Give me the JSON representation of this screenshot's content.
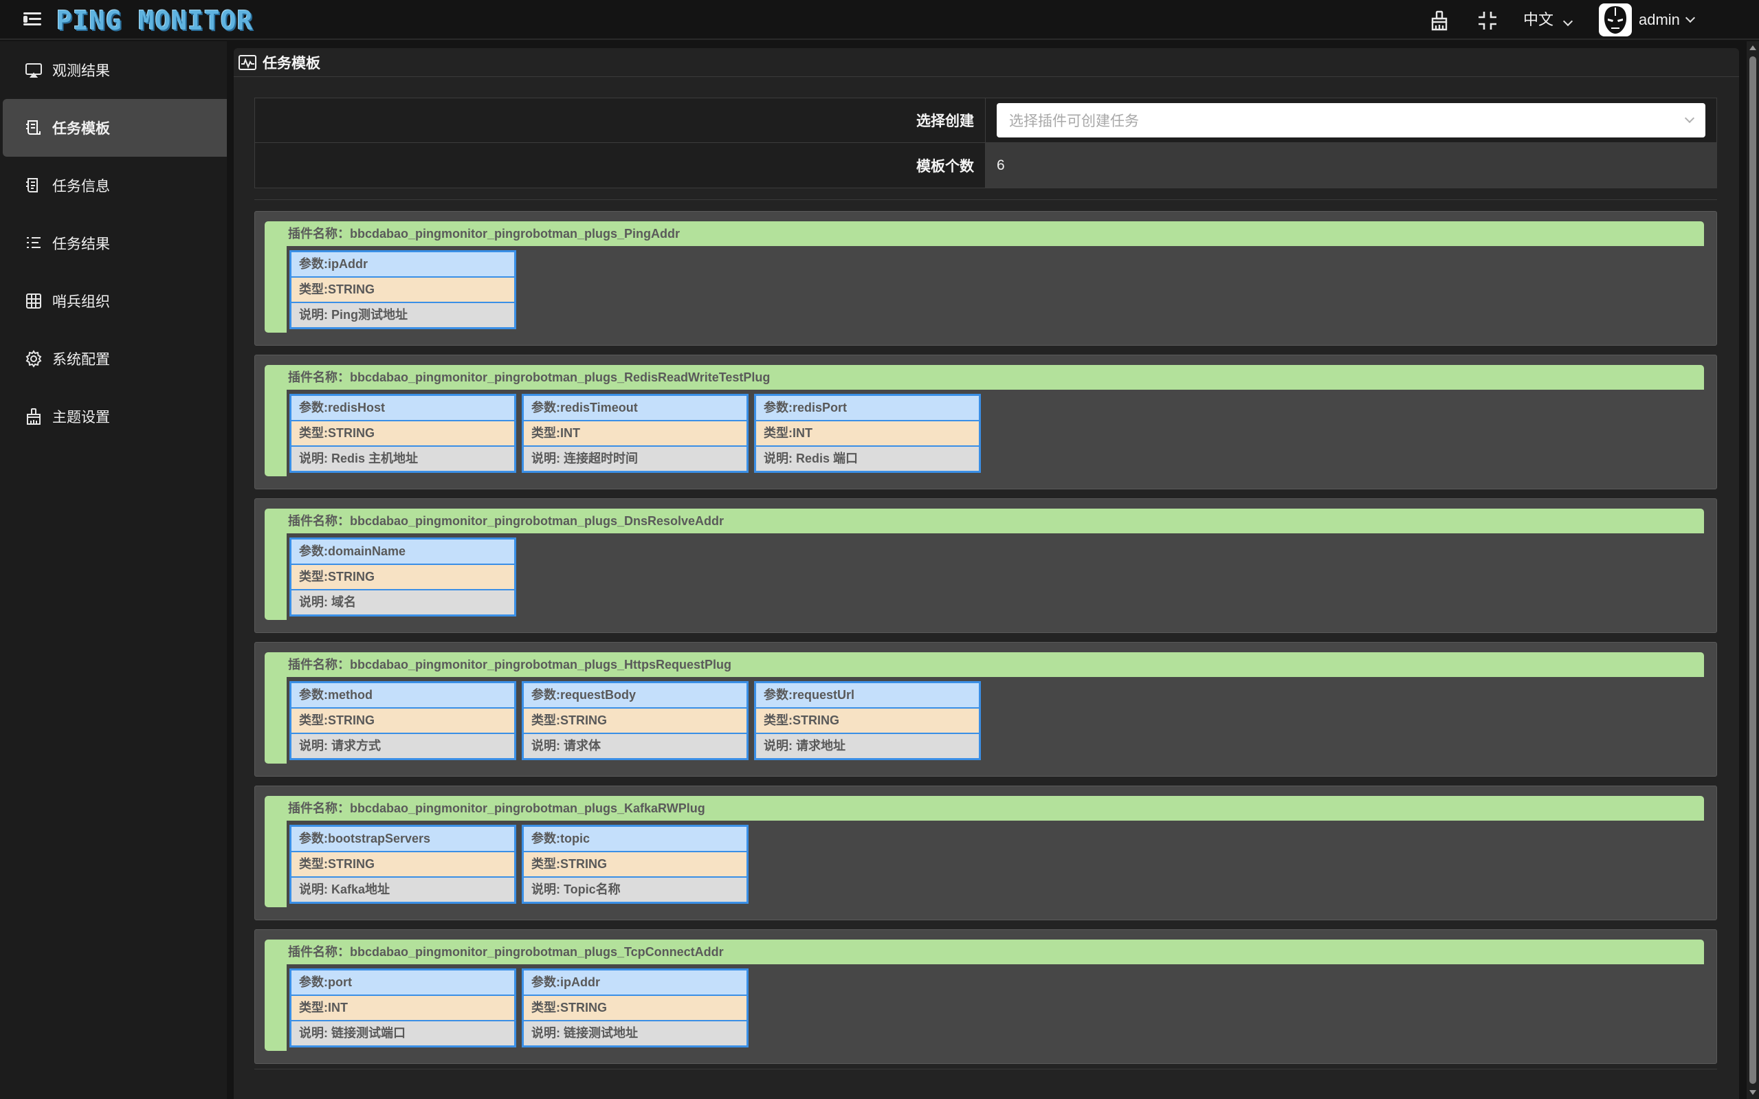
{
  "app": {
    "logo_text": "PING MONITOR",
    "language": "中文",
    "user_name": "admin"
  },
  "sidebar": {
    "items": [
      {
        "label": "观测结果",
        "icon": "monitor-icon"
      },
      {
        "label": "任务模板",
        "icon": "template-icon",
        "active": true
      },
      {
        "label": "任务信息",
        "icon": "task-info-icon"
      },
      {
        "label": "任务结果",
        "icon": "task-result-icon"
      },
      {
        "label": "哨兵组织",
        "icon": "grid-icon"
      },
      {
        "label": "系统配置",
        "icon": "gear-icon"
      },
      {
        "label": "主题设置",
        "icon": "brush-icon"
      }
    ]
  },
  "page": {
    "title": "任务模板",
    "select_label": "选择创建",
    "select_placeholder": "选择插件可创建任务",
    "count_label": "模板个数",
    "count_value": "6"
  },
  "plugins": [
    {
      "name": "插件名称：bbcdabao_pingmonitor_pingrobotman_plugs_PingAddr",
      "params": [
        {
          "name": "参数:ipAddr",
          "type": "类型:STRING",
          "desc": "说明: Ping测试地址"
        }
      ]
    },
    {
      "name": "插件名称：bbcdabao_pingmonitor_pingrobotman_plugs_RedisReadWriteTestPlug",
      "params": [
        {
          "name": "参数:redisHost",
          "type": "类型:STRING",
          "desc": "说明: Redis 主机地址"
        },
        {
          "name": "参数:redisTimeout",
          "type": "类型:INT",
          "desc": "说明: 连接超时时间"
        },
        {
          "name": "参数:redisPort",
          "type": "类型:INT",
          "desc": "说明: Redis 端口"
        }
      ]
    },
    {
      "name": "插件名称：bbcdabao_pingmonitor_pingrobotman_plugs_DnsResolveAddr",
      "params": [
        {
          "name": "参数:domainName",
          "type": "类型:STRING",
          "desc": "说明: 域名"
        }
      ]
    },
    {
      "name": "插件名称：bbcdabao_pingmonitor_pingrobotman_plugs_HttpsRequestPlug",
      "params": [
        {
          "name": "参数:method",
          "type": "类型:STRING",
          "desc": "说明: 请求方式"
        },
        {
          "name": "参数:requestBody",
          "type": "类型:STRING",
          "desc": "说明: 请求体"
        },
        {
          "name": "参数:requestUrl",
          "type": "类型:STRING",
          "desc": "说明: 请求地址"
        }
      ]
    },
    {
      "name": "插件名称：bbcdabao_pingmonitor_pingrobotman_plugs_KafkaRWPlug",
      "params": [
        {
          "name": "参数:bootstrapServers",
          "type": "类型:STRING",
          "desc": "说明: Kafka地址"
        },
        {
          "name": "参数:topic",
          "type": "类型:STRING",
          "desc": "说明: Topic名称"
        }
      ]
    },
    {
      "name": "插件名称：bbcdabao_pingmonitor_pingrobotman_plugs_TcpConnectAddr",
      "params": [
        {
          "name": "参数:port",
          "type": "类型:INT",
          "desc": "说明: 链接测试端口"
        },
        {
          "name": "参数:ipAddr",
          "type": "类型:STRING",
          "desc": "说明: 链接测试地址"
        }
      ]
    }
  ],
  "colors": {
    "accent_green": "#b3e19b",
    "param_border_blue": "#3a8fe6",
    "param_name_bg": "#c4dffb",
    "param_type_bg": "#f7e2c4",
    "param_desc_bg": "#dcdcdc"
  }
}
